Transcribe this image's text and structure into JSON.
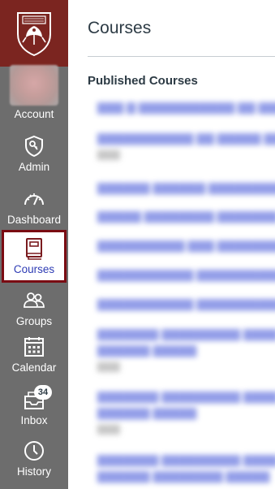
{
  "nav": {
    "account": {
      "label": "Account",
      "icon": "avatar"
    },
    "admin": {
      "label": "Admin",
      "icon": "shield-icon"
    },
    "dashboard": {
      "label": "Dashboard",
      "icon": "dashboard-icon"
    },
    "courses": {
      "label": "Courses",
      "icon": "book-icon",
      "active": true
    },
    "groups": {
      "label": "Groups",
      "icon": "groups-icon"
    },
    "calendar": {
      "label": "Calendar",
      "icon": "calendar-icon"
    },
    "inbox": {
      "label": "Inbox",
      "icon": "inbox-icon",
      "badge": "34"
    },
    "history": {
      "label": "History",
      "icon": "clock-icon"
    }
  },
  "page": {
    "title": "Courses",
    "section_title": "Published Courses"
  },
  "colors": {
    "nav_bg": "#6d6d6d",
    "logo_bg": "#7b2520",
    "active_border": "#7a0b12",
    "active_text": "#2d3bb4",
    "link": "#3b4fd6"
  }
}
